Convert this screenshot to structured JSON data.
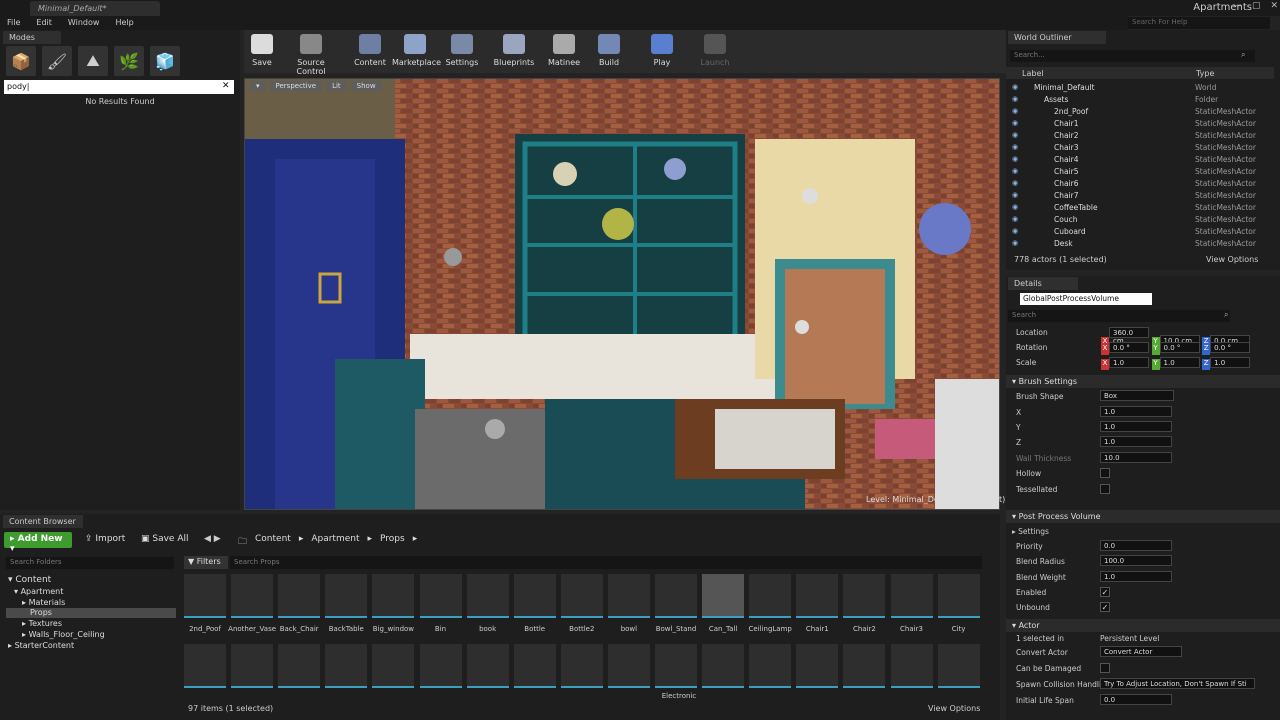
{
  "window": {
    "doc_tab": "Minimal_Default*",
    "app_name": "Apartments",
    "help_search_placeholder": "Search For Help"
  },
  "menu": [
    "File",
    "Edit",
    "Window",
    "Help"
  ],
  "modes": {
    "tab": "Modes",
    "search_value": "pody|",
    "no_results": "No Results Found"
  },
  "toolbar": [
    "Save",
    "Source Control",
    "Content",
    "Marketplace",
    "Settings",
    "Blueprints",
    "Matinee",
    "Build",
    "Play",
    "Launch"
  ],
  "viewport": {
    "perspective": "Perspective",
    "lit": "Lit",
    "show": "Show",
    "level_label": "Level:",
    "level_value": "Minimal_Default (Persistent)"
  },
  "outliner": {
    "tab": "World Outliner",
    "search_placeholder": "Search...",
    "col_label": "Label",
    "col_type": "Type",
    "rows": [
      {
        "label": "Minimal_Default",
        "type": "World",
        "indent": 0
      },
      {
        "label": "Assets",
        "type": "Folder",
        "indent": 1
      },
      {
        "label": "2nd_Poof",
        "type": "StaticMeshActor",
        "indent": 2
      },
      {
        "label": "Chair1",
        "type": "StaticMeshActor",
        "indent": 2
      },
      {
        "label": "Chair2",
        "type": "StaticMeshActor",
        "indent": 2
      },
      {
        "label": "Chair3",
        "type": "StaticMeshActor",
        "indent": 2
      },
      {
        "label": "Chair4",
        "type": "StaticMeshActor",
        "indent": 2
      },
      {
        "label": "Chair5",
        "type": "StaticMeshActor",
        "indent": 2
      },
      {
        "label": "Chair6",
        "type": "StaticMeshActor",
        "indent": 2
      },
      {
        "label": "Chair7",
        "type": "StaticMeshActor",
        "indent": 2
      },
      {
        "label": "CoffeeTable",
        "type": "StaticMeshActor",
        "indent": 2
      },
      {
        "label": "Couch",
        "type": "StaticMeshActor",
        "indent": 2
      },
      {
        "label": "Cuboard",
        "type": "StaticMeshActor",
        "indent": 2
      },
      {
        "label": "Desk",
        "type": "StaticMeshActor",
        "indent": 2
      }
    ],
    "actor_count": "778 actors (1 selected)",
    "view_options": "View Options"
  },
  "details": {
    "tab": "Details",
    "object_name": "GlobalPostProcessVolume",
    "search_placeholder": "Search",
    "location_label": "Location",
    "location": [
      "360.0 cm",
      "10.0 cm",
      "0.0 cm"
    ],
    "rotation_label": "Rotation",
    "rotation": [
      "0.0 °",
      "0.0 °",
      "0.0 °"
    ],
    "scale_label": "Scale",
    "scale": [
      "1.0",
      "1.0",
      "1.0"
    ],
    "brush_section": "Brush Settings",
    "brush_shape_label": "Brush Shape",
    "brush_shape": "Box",
    "x_label": "X",
    "x_value": "1.0",
    "y_label": "Y",
    "y_value": "1.0",
    "z_label": "Z",
    "z_value": "1.0",
    "wall_thickness_label": "Wall Thickness",
    "wall_thickness": "10.0",
    "hollow_label": "Hollow",
    "tessellated_label": "Tessellated",
    "ppv_section": "Post Process Volume",
    "settings_label": "Settings",
    "priority_label": "Priority",
    "priority": "0.0",
    "blend_radius_label": "Blend Radius",
    "blend_radius": "100.0",
    "blend_weight_label": "Blend Weight",
    "blend_weight": "1.0",
    "enabled_label": "Enabled",
    "unbound_label": "Unbound",
    "actor_section": "Actor",
    "selected_in_label": "1 selected in",
    "selected_in_value": "Persistent Level",
    "convert_actor_label": "Convert Actor",
    "convert_actor_value": "Convert Actor",
    "can_be_damaged_label": "Can be Damaged",
    "spawn_label": "Spawn Collision Handlin",
    "spawn_value": "Try To Adjust Location, Don't Spawn If Sti",
    "life_span_label": "Initial Life Span",
    "life_span": "0.0"
  },
  "content_browser": {
    "tab": "Content Browser",
    "add_new": "Add New",
    "import": "Import",
    "save_all": "Save All",
    "crumbs": [
      "Content",
      "Apartment",
      "Props"
    ],
    "folder_search_placeholder": "Search Folders",
    "tree": [
      "Content",
      "Apartment",
      "Materials",
      "Props",
      "Textures",
      "Walls_Floor_Ceiling",
      "StarterContent"
    ],
    "filters": "Filters",
    "asset_search_placeholder": "Search Props",
    "assets_row1": [
      "2nd_Poof",
      "Another_Vase",
      "Back_Chair",
      "BackTable",
      "Big_window",
      "Bin",
      "book",
      "Bottle",
      "Bottle2",
      "bowl",
      "Bowl_Stand",
      "Can_Tall",
      "CeilingLamp",
      "Chair1",
      "Chair2",
      "Chair3",
      "City"
    ],
    "assets_row2_partial": "Electronic",
    "items_count": "97 items (1 selected)",
    "view_options": "View Options"
  }
}
